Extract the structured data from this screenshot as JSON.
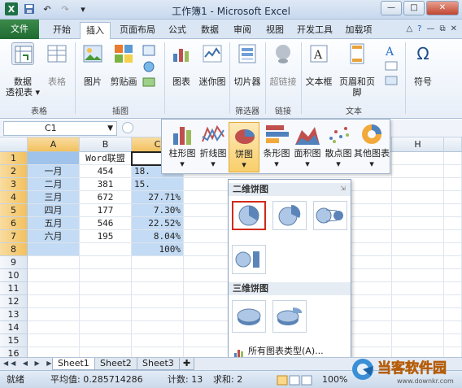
{
  "window": {
    "title": "工作簿1 - Microsoft Excel"
  },
  "tabs": [
    "文件",
    "开始",
    "插入",
    "页面布局",
    "公式",
    "数据",
    "审阅",
    "视图",
    "开发工具",
    "加载项"
  ],
  "ribbon": {
    "buttons": {
      "pivot": "数据",
      "pivot2": "透视表 ▾",
      "table": "表格",
      "picture": "图片",
      "clipart": "剪贴画",
      "chart": "图表",
      "sparkline": "迷你图",
      "slicer": "切片器",
      "hyperlink": "超链接",
      "textbox": "文本框",
      "headerfooter": "页眉和页脚",
      "symbol": "符号"
    },
    "groups": {
      "tables": "表格",
      "illustrations": "插图",
      "filter": "筛选器",
      "links": "链接",
      "text": "文本"
    }
  },
  "formula_bar": {
    "name_box": "C1"
  },
  "chart_types": [
    "柱形图",
    "折线图",
    "饼图",
    "条形图",
    "面积图",
    "散点图",
    "其他图表"
  ],
  "pie_gallery": {
    "section_2d": "二维饼图",
    "section_3d": "三维饼图",
    "all_types": "所有图表类型(A)..."
  },
  "sheet": {
    "columns": [
      "A",
      "B",
      "C",
      "H"
    ],
    "rows": [
      "1",
      "2",
      "3",
      "4",
      "5",
      "6",
      "7",
      "8",
      "9",
      "10",
      "11",
      "12",
      "13",
      "14",
      "15",
      "16"
    ],
    "header_b": "Word联盟",
    "data": [
      {
        "a": "一月",
        "b": "454",
        "c": "18."
      },
      {
        "a": "二月",
        "b": "381",
        "c": "15."
      },
      {
        "a": "三月",
        "b": "672",
        "c": "27.71%"
      },
      {
        "a": "四月",
        "b": "177",
        "c": "7.30%"
      },
      {
        "a": "五月",
        "b": "546",
        "c": "22.52%"
      },
      {
        "a": "六月",
        "b": "195",
        "c": "8.04%"
      }
    ],
    "total_c": "100%"
  },
  "sheet_tabs": [
    "Sheet1",
    "Sheet2",
    "Sheet3"
  ],
  "status": {
    "ready": "就绪",
    "average": "平均值: 0.285714286",
    "count": "计数: 13",
    "sum": "求和: 2",
    "zoom": "100%"
  },
  "watermark": {
    "brand": "当客软件园",
    "url": "www.downkr.com"
  }
}
